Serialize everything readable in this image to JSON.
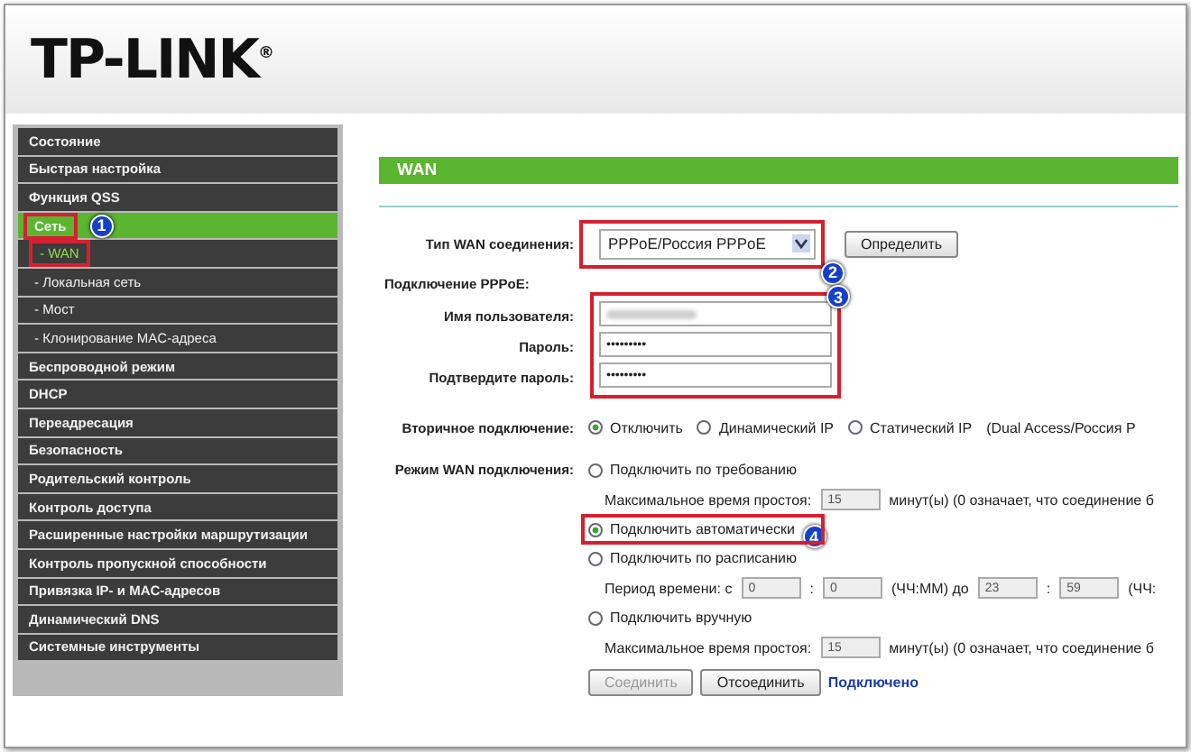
{
  "header": {
    "logo": "TP-LINK",
    "logo_mark": "®"
  },
  "sidebar": {
    "items": [
      {
        "label": "Состояние",
        "selected": false
      },
      {
        "label": "Быстрая настройка",
        "selected": false
      },
      {
        "label": "Функция QSS",
        "selected": false
      },
      {
        "label": "Сеть",
        "selected": true,
        "outlined": true,
        "marker": "1",
        "children": [
          {
            "label": "- WAN",
            "selected": true,
            "outlined": true
          },
          {
            "label": "- Локальная сеть",
            "selected": false
          },
          {
            "label": "- Мост",
            "selected": false
          },
          {
            "label": "- Клонирование MAC-адреса",
            "selected": false
          }
        ]
      },
      {
        "label": "Беспроводной режим",
        "selected": false
      },
      {
        "label": "DHCP",
        "selected": false
      },
      {
        "label": "Переадресация",
        "selected": false
      },
      {
        "label": "Безопасность",
        "selected": false
      },
      {
        "label": "Родительский контроль",
        "selected": false
      },
      {
        "label": "Контроль доступа",
        "selected": false
      },
      {
        "label": "Расширенные настройки маршрутизации",
        "selected": false
      },
      {
        "label": "Контроль пропускной способности",
        "selected": false
      },
      {
        "label": "Привязка IP- и MAC-адресов",
        "selected": false
      },
      {
        "label": "Динамический DNS",
        "selected": false
      },
      {
        "label": "Системные инструменты",
        "selected": false
      }
    ]
  },
  "panel": {
    "title": "WAN",
    "wan_type": {
      "label": "Тип WAN соединения:",
      "value": "PPPoE/Россия PPPoE",
      "marker": "2",
      "detect_button": "Определить"
    },
    "pppoe": {
      "heading": "Подключение PPPoE:",
      "marker": "3",
      "fields": [
        {
          "label": "Имя пользователя:",
          "kind": "blurred"
        },
        {
          "label": "Пароль:",
          "kind": "password",
          "value": "•••••••••"
        },
        {
          "label": "Подтвердите пароль:",
          "kind": "password",
          "value": "•••••••••"
        }
      ]
    },
    "secondary": {
      "label": "Вторичное подключение:",
      "options": [
        {
          "label": "Отключить",
          "selected": true
        },
        {
          "label": "Динамический IP",
          "selected": false
        },
        {
          "label": "Статический IP",
          "selected": false
        }
      ],
      "note": "(Dual Access/Россия P"
    },
    "mode": {
      "label": "Режим WAN подключения:",
      "options": [
        {
          "label": "Подключить по требованию",
          "selected": false,
          "detail": {
            "kind": "idle",
            "label": "Максимальное время простоя:",
            "value": "15",
            "note": "минут(ы) (0 означает, что соединение б"
          }
        },
        {
          "label": "Подключить автоматически",
          "selected": true,
          "outlined": true,
          "marker": "4"
        },
        {
          "label": "Подключить по расписанию",
          "selected": false,
          "detail": {
            "kind": "period",
            "label": "Период времени: с",
            "from_h": "0",
            "separator": ":",
            "from_m": "0",
            "unit": "(ЧЧ:ММ) до",
            "to_h": "23",
            "to_m": "59",
            "note": "(ЧЧ:"
          }
        },
        {
          "label": "Подключить вручную",
          "selected": false,
          "detail": {
            "kind": "idle",
            "label": "Максимальное время простоя:",
            "value": "15",
            "note": "минут(ы) (0 означает, что соединение б"
          }
        }
      ]
    },
    "buttons": [
      {
        "label": "Соединить",
        "disabled": true
      },
      {
        "label": "Отсоединить",
        "disabled": false
      }
    ],
    "status": "Подключено"
  }
}
